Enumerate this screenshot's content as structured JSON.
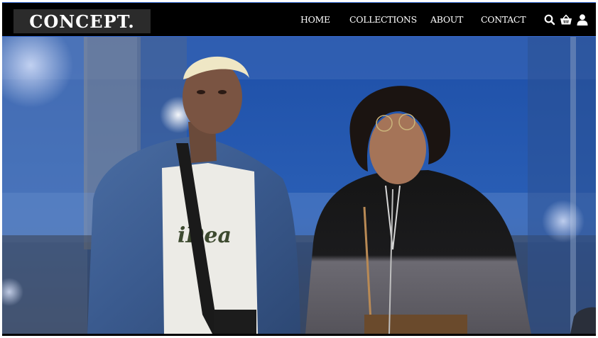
{
  "brand": {
    "logo_text": "CONCEPT."
  },
  "nav": {
    "items": [
      {
        "label": "HOME"
      },
      {
        "label": "COLLECTIONS"
      },
      {
        "label": "ABOUT"
      },
      {
        "label": "CONTACT"
      }
    ]
  },
  "icons": {
    "search": "search-icon",
    "basket": "shopping-basket-icon",
    "user": "user-icon"
  },
  "hero": {
    "shirt_print_text": "iDea"
  },
  "colors": {
    "navbar_background": "#000000",
    "navbar_border": "#3b6fd8",
    "logo_background": "#2b2b2b",
    "text": "#ffffff"
  }
}
